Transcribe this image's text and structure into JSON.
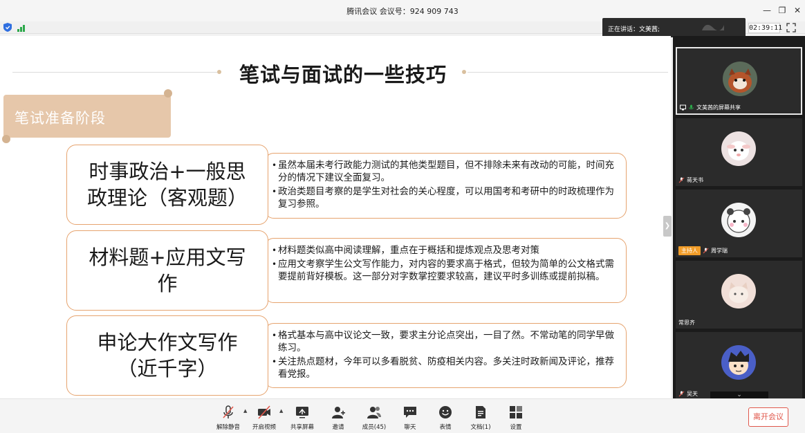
{
  "window": {
    "title": "腾讯会议 会议号：924 909 743",
    "minimize_icon": "minimize-icon",
    "restore_icon": "restore-icon",
    "close_icon": "close-icon"
  },
  "status": {
    "speaking_text": "正在讲话：文美茜;",
    "timer": "02:39:11"
  },
  "slide": {
    "title": "笔试与面试的一些技巧",
    "banner": "笔试准备阶段",
    "sections": [
      {
        "topic_line1": "时事政治+一般思",
        "topic_line2": "政理论（客观题）",
        "bullets": [
          "虽然本届未考行政能力测试的其他类型题目，但不排除未来有改动的可能，时间充分的情况下建议全面复习。",
          "政治类题目考察的是学生对社会的关心程度，可以用国考和考研中的时政梳理作为复习参照。"
        ]
      },
      {
        "topic_line1": "材料题+应用文写",
        "topic_line2": "作",
        "bullets": [
          "材料题类似高中阅读理解，重点在于概括和提炼观点及思考对策",
          "应用文考察学生公文写作能力，对内容的要求高于格式，但较为简单的公文格式需要提前背好模板。这一部分对字数掌控要求较高，建议平时多训练或提前拟稿。"
        ]
      },
      {
        "topic_line1": "申论大作文写作",
        "topic_line2": "（近千字）",
        "bullets": [
          "格式基本与高中议论文一致，要求主分论点突出，一目了然。不常动笔的同学早做练习。",
          "关注热点题材，今年可以多看脱贫、防疫相关内容。多关注时政新闻及评论，推荐看党报。"
        ]
      }
    ]
  },
  "participants": [
    {
      "name": "文美茜的屏幕共享",
      "host": false
    },
    {
      "name": "蒋天书",
      "host": false
    },
    {
      "name": "周学瑞",
      "host": true,
      "host_label": "主持人"
    },
    {
      "name": "常思齐",
      "host": false
    },
    {
      "name": "吴天",
      "host": false
    }
  ],
  "toolbar": {
    "items": [
      {
        "label": "解除静音",
        "icon": "mic-muted-icon"
      },
      {
        "label": "开启视频",
        "icon": "camera-off-icon"
      },
      {
        "label": "共享屏幕",
        "icon": "share-screen-icon"
      },
      {
        "label": "邀请",
        "icon": "invite-icon"
      },
      {
        "label": "成员(45)",
        "icon": "members-icon"
      },
      {
        "label": "聊天",
        "icon": "chat-icon"
      },
      {
        "label": "表情",
        "icon": "emoji-icon"
      },
      {
        "label": "文档(1)",
        "icon": "document-icon"
      },
      {
        "label": "设置",
        "icon": "settings-icon"
      }
    ],
    "leave_label": "离开会议"
  },
  "colors": {
    "accent_border": "#e6a36e",
    "banner": "#e6c7aa",
    "host_tag": "#f29d29",
    "leave": "#e0574b"
  }
}
